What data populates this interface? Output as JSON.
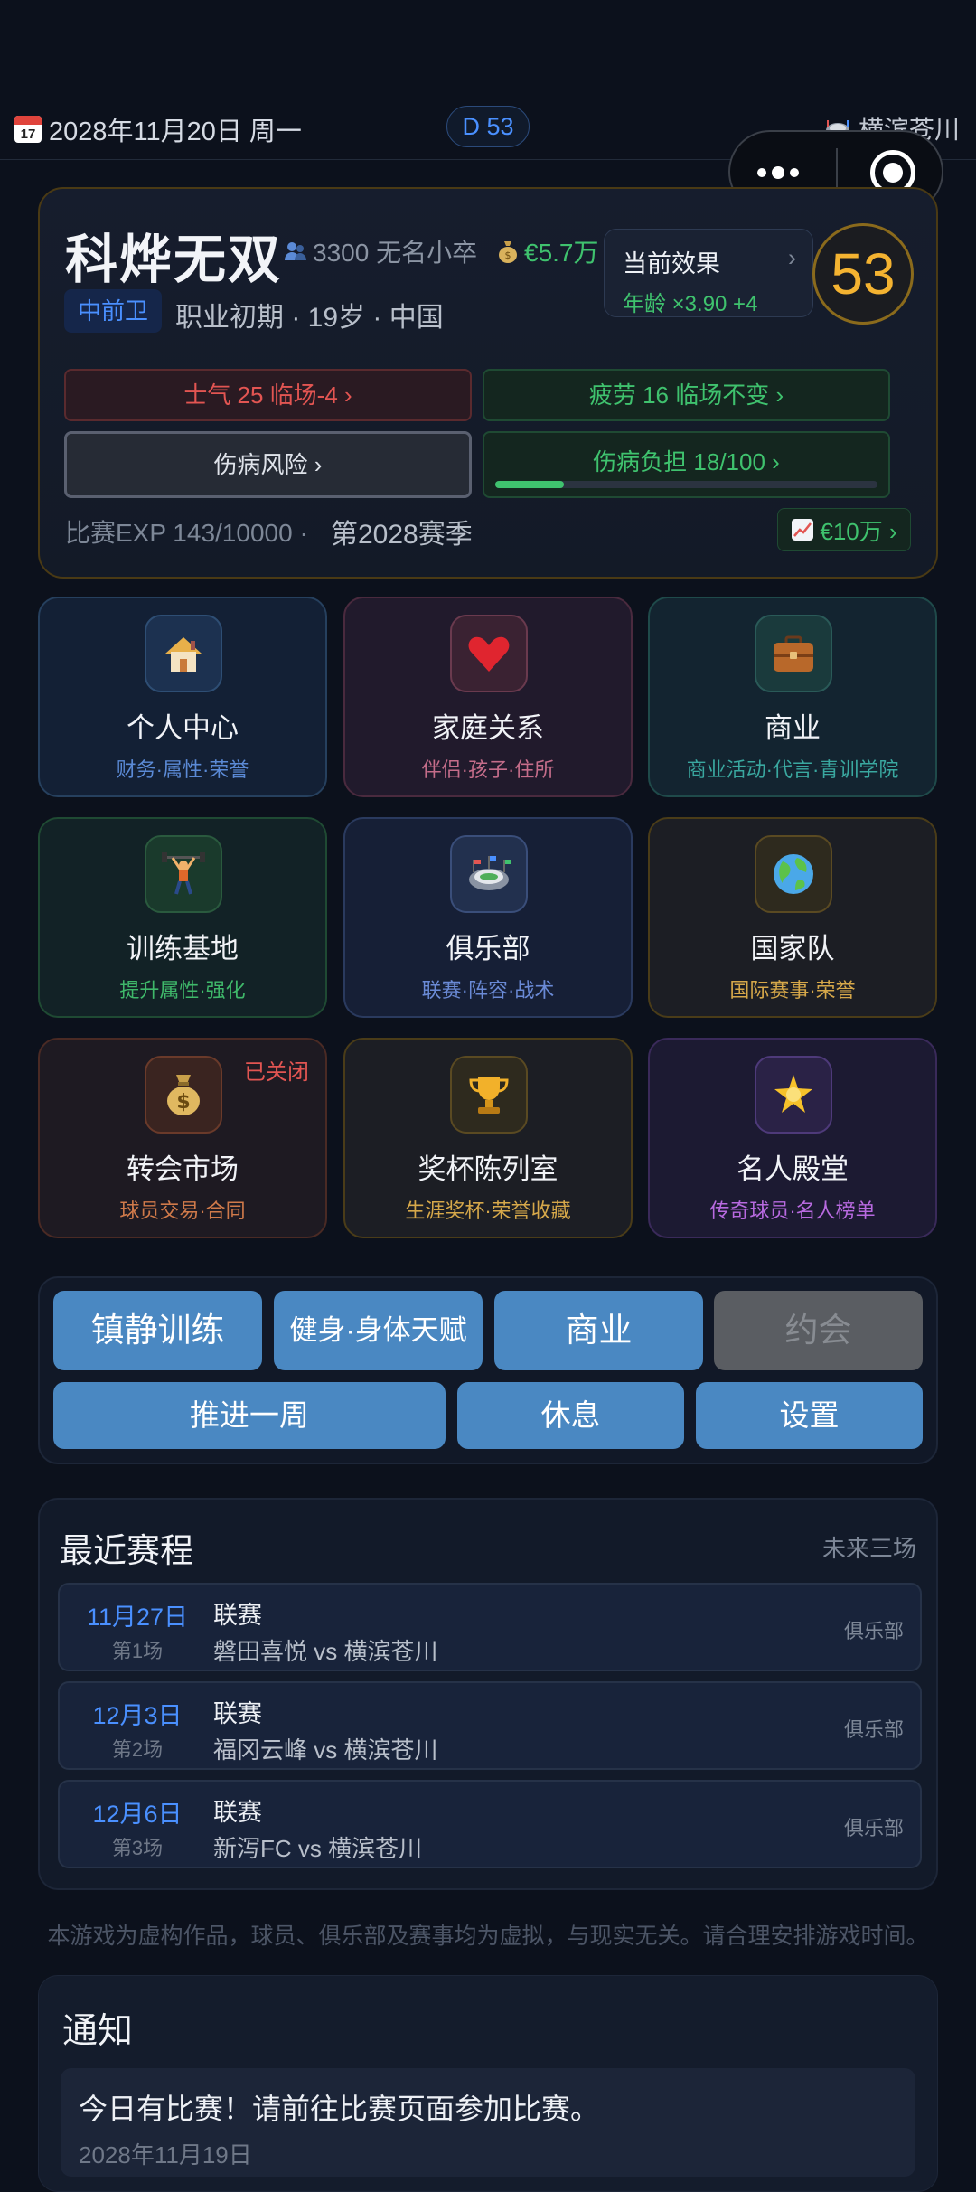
{
  "status": {
    "date": "2028年11月20日 周一",
    "calendar_day": "17",
    "day_counter": "D 53",
    "team": "横滨苍川"
  },
  "profile": {
    "name": "科烨无双",
    "fans": "3300 无名小卒",
    "money": "€5.7万",
    "effect_title": "当前效果",
    "effect_chevron": "›",
    "effect_value": "年龄 ×3.90  +4",
    "rating": "53",
    "position": "中前卫",
    "career": "职业初期 · 19岁 · 中国",
    "morale": "士气 25  临场-4 ›",
    "fatigue": "疲劳 16  临场不变 ›",
    "injury_risk": "伤病风险 ›",
    "injury_burden": "伤病负担 18/100 ›",
    "injury_burden_fraction": 0.18,
    "exp": "比赛EXP 143/10000  ·",
    "season": "第2028赛季",
    "market_value": "€10万 ›"
  },
  "tiles": [
    {
      "name": "个人中心",
      "sub": "财务·属性·荣誉",
      "icon": "house-icon"
    },
    {
      "name": "家庭关系",
      "sub": "伴侣·孩子·住所",
      "icon": "heart-icon"
    },
    {
      "name": "商业",
      "sub": "商业活动·代言·青训学院",
      "icon": "briefcase-icon"
    },
    {
      "name": "训练基地",
      "sub": "提升属性·强化",
      "icon": "weightlifter-icon"
    },
    {
      "name": "俱乐部",
      "sub": "联赛·阵容·战术",
      "icon": "stadium-icon"
    },
    {
      "name": "国家队",
      "sub": "国际赛事·荣誉",
      "icon": "globe-icon"
    },
    {
      "name": "转会市场",
      "sub": "球员交易·合同",
      "icon": "money-bag-icon",
      "badge": "已关闭"
    },
    {
      "name": "奖杯陈列室",
      "sub": "生涯奖杯·荣誉收藏",
      "icon": "trophy-icon"
    },
    {
      "name": "名人殿堂",
      "sub": "传奇球员·名人榜单",
      "icon": "star-icon"
    }
  ],
  "actions": {
    "calm_training": "镇静训练",
    "fitness": "健身·身体天赋",
    "business": "商业",
    "date": "约会",
    "advance_week": "推进一周",
    "rest": "休息",
    "settings": "设置"
  },
  "schedule": {
    "title": "最近赛程",
    "subtitle": "未来三场",
    "matches": [
      {
        "date": "11月27日",
        "round": "第1场",
        "comp": "联赛",
        "fixture": "磐田喜悦  vs  横滨苍川",
        "tag": "俱乐部"
      },
      {
        "date": "12月3日",
        "round": "第2场",
        "comp": "联赛",
        "fixture": "福冈云峰  vs  横滨苍川",
        "tag": "俱乐部"
      },
      {
        "date": "12月6日",
        "round": "第3场",
        "comp": "联赛",
        "fixture": "新泻FC  vs  横滨苍川",
        "tag": "俱乐部"
      }
    ]
  },
  "disclaimer": "本游戏为虚构作品，球员、俱乐部及赛事均为虚拟，与现实无关。请合理安排游戏时间。",
  "notice": {
    "title": "通知",
    "message": "今日有比赛！请前往比赛页面参加比赛。",
    "date": "2028年11月19日"
  }
}
